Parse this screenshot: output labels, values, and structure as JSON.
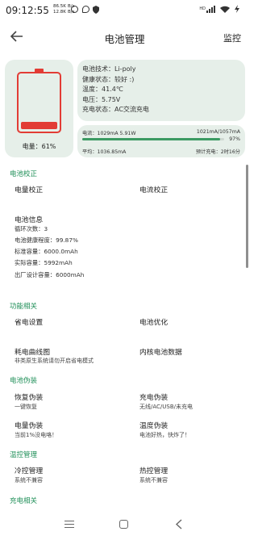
{
  "status_bar": {
    "time": "09:12:55",
    "net_up": "86.5K",
    "net_down": "12.8K",
    "net_unit_up": "B/s",
    "net_unit_down": "B/s",
    "network": "HD",
    "wifi": "wifi",
    "icons": [
      "location-icon",
      "chat-icon",
      "shield-icon",
      "signal-icon",
      "wifi-icon",
      "charging-icon"
    ]
  },
  "app_bar": {
    "title": "电池管理",
    "monitor": "监控"
  },
  "battery": {
    "level_text": "电量：61%",
    "level": 0.12,
    "color": "#e23c35"
  },
  "info": {
    "tech": "电池技术：Li-poly",
    "health": "健康状态：较好 :)",
    "temp": "温度：41.4℃",
    "voltage": "电压：5.75V",
    "charge_state": "充电状态：AC交流充电"
  },
  "stats": {
    "current": "电流：1029mA    5.91W",
    "capacity": "1021mA/1057mA",
    "percent_text": "97%",
    "percent": 0.97,
    "average": "平均：1036.85mA",
    "eta": "预计充电：2时16分",
    "bar_color": "#3c9a63"
  },
  "sections": {
    "calibration": {
      "header": "电池校正",
      "capacity_calibration": "电量校正",
      "current_calibration": "电流校正"
    },
    "battery_info": {
      "title": "电池信息",
      "cycles": "循环次数：3",
      "health_degree": "电池健康程度：99.87%",
      "standard_capacity": "标准容量：6000.0mAh",
      "actual_capacity": "实际容量：5992mAh",
      "factory_capacity": "出厂设计容量：6000mAh"
    },
    "functions": {
      "header": "功能相关",
      "power_saving": "省电设置",
      "battery_optimization": "电池优化",
      "consumption_curve": "耗电曲线图",
      "consumption_curve_sub": "非类原生系统请勿开启省电模式",
      "kernel_data": "内核电池数据"
    },
    "disguise": {
      "header": "电池伪装",
      "restore": "恢复伪装",
      "restore_sub": "一键恢复",
      "charge_disguise": "充电伪装",
      "charge_disguise_sub": "无线/AC/USB/未充电",
      "level_disguise": "电量伪装",
      "level_disguise_sub": "当前1%没电咯！",
      "temp_disguise": "温度伪装",
      "temp_disguise_sub": "电池好热，快炸了！"
    },
    "thermal": {
      "header": "温控管理",
      "cooling": "冷控管理",
      "cooling_sub": "系统不兼容",
      "heat": "热控管理",
      "heat_sub": "系统不兼容"
    },
    "charging": {
      "header": "充电相关"
    }
  },
  "nav_bar": {
    "icons": [
      "menu-icon",
      "home-icon",
      "back-icon"
    ]
  }
}
